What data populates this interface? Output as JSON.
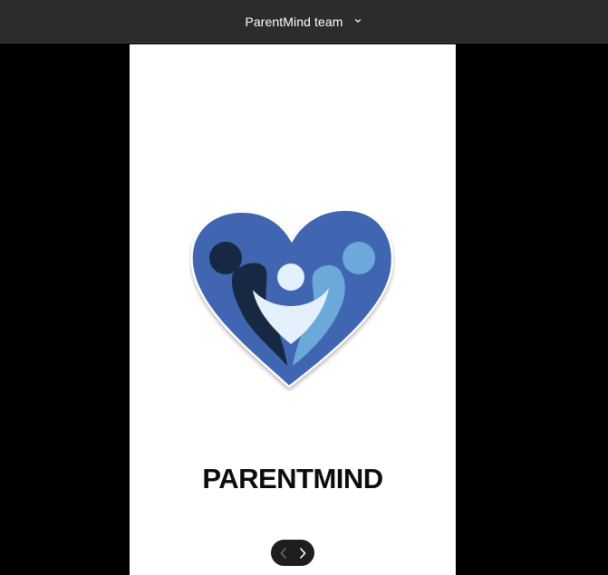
{
  "header": {
    "team_name": "ParentMind team",
    "dropdown_icon": "chevron-down-icon"
  },
  "screen": {
    "brand_name": "PARENTMIND",
    "logo": "heart-family-logo"
  },
  "navigation": {
    "prev_icon": "chevron-left-icon",
    "next_icon": "chevron-right-icon",
    "prev_enabled": false,
    "next_enabled": true
  },
  "colors": {
    "topbar_bg": "#2c2c2c",
    "heart_blue": "#3f66b1",
    "dark_navy": "#172842",
    "light_blue": "#6ca8da",
    "pale_blue": "#e4f1fc",
    "nav_pill_bg": "#1e1e1e"
  }
}
